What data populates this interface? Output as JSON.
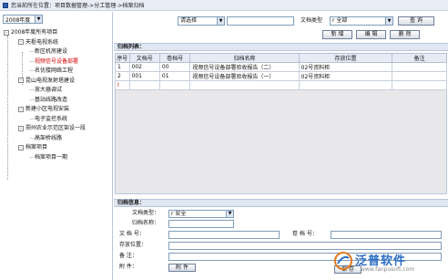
{
  "titlebar": {
    "crumb": "您当前所在位置：项目数据管理->分工管理->档案归档"
  },
  "left": {
    "year": "2008年度",
    "tree": [
      {
        "label": "2008年度所有项目",
        "level": 0,
        "box": "-"
      },
      {
        "label": "天枢电视系统",
        "level": 1,
        "box": "-"
      },
      {
        "label": "新区机房建设",
        "level": 2
      },
      {
        "label": "视频信号设备部署",
        "level": 2,
        "selected": true
      },
      {
        "label": "名优楼网络工程",
        "level": 2
      },
      {
        "label": "昆山电视发射塔建设",
        "level": 1,
        "box": "-"
      },
      {
        "label": "放大器调试",
        "level": 2
      },
      {
        "label": "基站线路改造",
        "level": 2
      },
      {
        "label": "新建小区电视安装",
        "level": 1,
        "box": "-"
      },
      {
        "label": "电子监控系统",
        "level": 2
      },
      {
        "label": "郑州农业示范区架设一段",
        "level": 1,
        "box": "-"
      },
      {
        "label": "高架桥线路",
        "level": 2
      },
      {
        "label": "档案项目",
        "level": 1,
        "box": "-"
      },
      {
        "label": "档案项目一期",
        "level": 2
      }
    ]
  },
  "toolbar": {
    "type_select": "请选择",
    "search_value": "",
    "category_label": "文档类型",
    "category_value": "r 全部",
    "query_label": "查 询",
    "add_label": "新 增",
    "edit_label": "编 辑",
    "delete_label": "删 除"
  },
  "list": {
    "header": "归档列表：",
    "columns": [
      "序号",
      "文档号",
      "卷档号",
      "归档名称",
      "存放位置",
      "备注"
    ],
    "rows": [
      [
        "1",
        "002",
        "00",
        "视频信号设备部署验收报告（二）",
        "02号资料柜",
        ""
      ],
      [
        "2",
        "001",
        "01",
        "视频信号设备部署验收报告（一）",
        "02号资料柜",
        ""
      ]
    ],
    "new_row_marker": "I"
  },
  "form": {
    "header": "归档信息：",
    "doc_type_label": "文档类型：",
    "doc_type_value": "r 安全",
    "name_label": "归档名称：",
    "doc_no_label": "文 档 号：",
    "vol_no_label": "卷 档 号：",
    "location_label": "存放位置：",
    "remark_label": "备    注：",
    "attach_label": "附    件：",
    "attach_btn": "附 件",
    "save_btn": "保 存"
  },
  "watermark": {
    "brand": "泛普软件",
    "url": "www.fanpusoft.com"
  },
  "colors": {
    "selected_node": "#d00000",
    "brand": "#2b6cc4"
  }
}
